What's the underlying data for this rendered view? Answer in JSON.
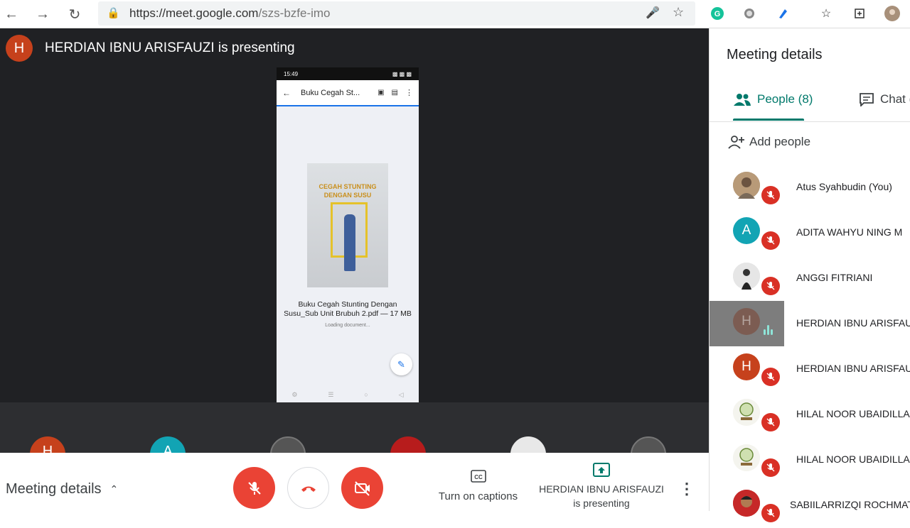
{
  "browser": {
    "url_host": "https://meet.google.com",
    "url_path": "/szs-bzfe-imo"
  },
  "stage": {
    "presenter_initial": "H",
    "presenter_text": "HERDIAN IBNU ARISFAUZI is presenting"
  },
  "phone": {
    "time": "15:49",
    "title": "Buku Cegah St...",
    "book_line1": "CEGAH STUNTING",
    "book_line2": "DENGAN SUSU",
    "file_name": "Buku Cegah Stunting Dengan Susu_Sub Unit Brubuh 2.pdf — 17 MB",
    "loading": "Loading document..."
  },
  "filmstrip": [
    {
      "initial": "H",
      "color": "#c6411c"
    },
    {
      "initial": "A",
      "color": "#12a4b4"
    },
    {
      "initial": "",
      "color": "#555"
    },
    {
      "initial": "",
      "color": "#b71c1c"
    },
    {
      "initial": "",
      "color": "#e8e8e8"
    },
    {
      "initial": "",
      "color": "#555"
    }
  ],
  "bottom": {
    "meeting_details": "Meeting details",
    "captions_label": "Turn on captions",
    "presenting_label_1": "HERDIAN IBNU ARISFAUZI",
    "presenting_label_2": "is presenting"
  },
  "panel": {
    "title": "Meeting details",
    "tab_people": "People (8)",
    "tab_chat": "Chat (",
    "add_people": "Add people",
    "participants": [
      {
        "name": "Atus Syahbudin (You)",
        "initial": "",
        "avatar_color": "#9a8266",
        "muted": true,
        "active": false
      },
      {
        "name": "ADITA WAHYU NING M",
        "initial": "A",
        "avatar_color": "#12a4b4",
        "muted": true,
        "active": false
      },
      {
        "name": "ANGGI FITRIANI",
        "initial": "",
        "avatar_color": "#e0e0e0",
        "muted": true,
        "active": false
      },
      {
        "name": "HERDIAN IBNU ARISFAUZI",
        "initial": "H",
        "avatar_color": "#7c5c52",
        "muted": false,
        "active": true
      },
      {
        "name": "HERDIAN IBNU ARISFAUZI",
        "initial": "H",
        "avatar_color": "#c6411c",
        "muted": true,
        "active": false
      },
      {
        "name": "HILAL NOOR UBAIDILLAH",
        "initial": "",
        "avatar_color": "#f4f4ee",
        "muted": true,
        "active": false
      },
      {
        "name": "HILAL NOOR UBAIDILLAH",
        "initial": "",
        "avatar_color": "#f4f4ee",
        "muted": true,
        "active": false
      },
      {
        "name": "SABIILARRIZQI ROCHMATU",
        "initial": "",
        "avatar_color": "#b71c1c",
        "muted": true,
        "active": false
      }
    ]
  },
  "colors": {
    "accent": "#00796b",
    "danger": "#ea4335",
    "stage_bg": "#202124"
  }
}
